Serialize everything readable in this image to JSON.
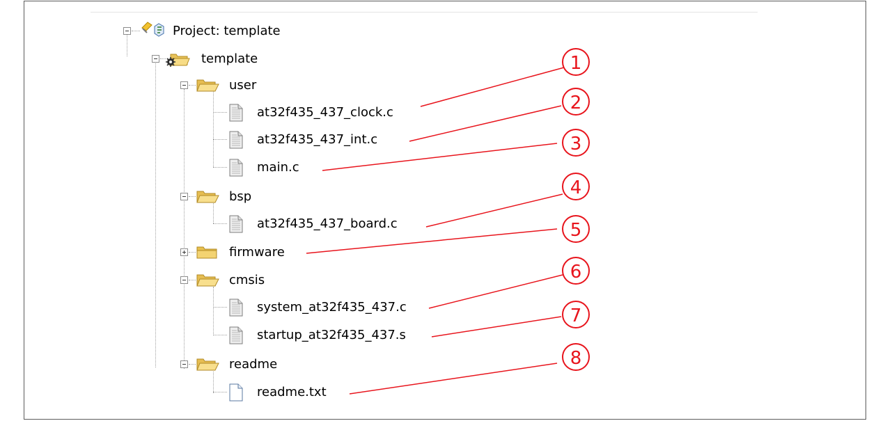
{
  "tree": {
    "project_label": "Project: template",
    "target_label": "template",
    "groups": [
      {
        "label": "user",
        "expanded": true,
        "files": [
          "at32f435_437_clock.c",
          "at32f435_437_int.c",
          "main.c"
        ]
      },
      {
        "label": "bsp",
        "expanded": true,
        "files": [
          "at32f435_437_board.c"
        ]
      },
      {
        "label": "firmware",
        "expanded": false,
        "files": []
      },
      {
        "label": "cmsis",
        "expanded": true,
        "files": [
          "system_at32f435_437.c",
          "startup_at32f435_437.s"
        ]
      },
      {
        "label": "readme",
        "expanded": true,
        "files": [
          "readme.txt"
        ]
      }
    ]
  },
  "annotations": {
    "color": "#e8141c",
    "markers": [
      "1",
      "2",
      "3",
      "4",
      "5",
      "6",
      "7",
      "8"
    ]
  },
  "icons": {
    "project": "project-icon",
    "target": "target-folder-icon",
    "open_folder": "open-folder-icon",
    "closed_folder": "closed-folder-icon",
    "file": "c-file-icon",
    "text_file": "text-file-icon"
  }
}
